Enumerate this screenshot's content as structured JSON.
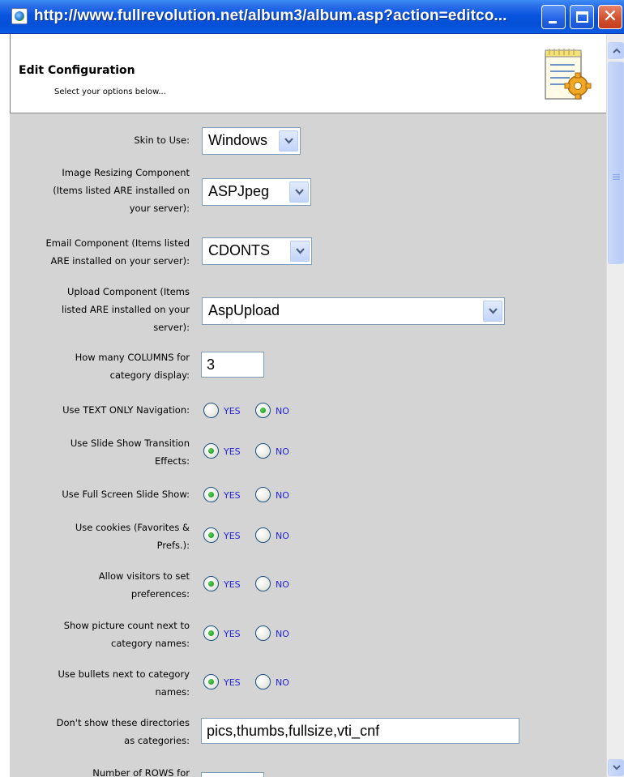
{
  "window": {
    "title": "http://www.fullrevolution.net/album3/album.asp?action=editco..."
  },
  "header": {
    "title": "Edit Configuration",
    "subtitle": "Select your options below..."
  },
  "radio_labels": {
    "yes": "YES",
    "no": "NO"
  },
  "fields": {
    "skin": {
      "label": "Skin to Use:",
      "value": "Windows"
    },
    "image_resizing": {
      "label_lines": [
        "Image Resizing Component",
        "(Items listed ARE installed on",
        "your server):"
      ],
      "value": "ASPJpeg"
    },
    "email": {
      "label_lines": [
        "Email Component (Items listed",
        "ARE installed on your server):"
      ],
      "value": "CDONTS"
    },
    "upload": {
      "label_lines": [
        "Upload Component (Items",
        "listed ARE installed on your",
        "server):"
      ],
      "value": "AspUpload"
    },
    "columns": {
      "label_lines": [
        "How many COLUMNS for",
        "category display:"
      ],
      "value": "3"
    },
    "text_only_nav": {
      "label": "Use TEXT ONLY Navigation:",
      "selected": "no"
    },
    "slide_transition": {
      "label_lines": [
        "Use Slide Show Transition",
        "Effects:"
      ],
      "selected": "yes"
    },
    "full_screen": {
      "label": "Use Full Screen Slide Show:",
      "selected": "yes"
    },
    "cookies": {
      "label_lines": [
        "Use cookies (Favorites &",
        "Prefs.):"
      ],
      "selected": "yes"
    },
    "visitor_prefs": {
      "label_lines": [
        "Allow visitors to set",
        "preferences:"
      ],
      "selected": "yes"
    },
    "picture_count": {
      "label_lines": [
        "Show picture count next to",
        "category names:"
      ],
      "selected": "yes"
    },
    "bullets": {
      "label_lines": [
        "Use bullets next to category",
        "names:"
      ],
      "selected": "yes"
    },
    "hidden_dirs": {
      "label_lines": [
        "Don't show these directories",
        "as categories:"
      ],
      "value": "pics,thumbs,fullsize,vti_cnf"
    },
    "rows": {
      "label_lines": [
        "Number of ROWS for"
      ],
      "value": ""
    }
  },
  "icons": {
    "window": "ie-page-icon",
    "header": "config-document-gear-icon",
    "minimize": "minimize-icon",
    "maximize": "maximize-icon",
    "close": "close-icon"
  }
}
